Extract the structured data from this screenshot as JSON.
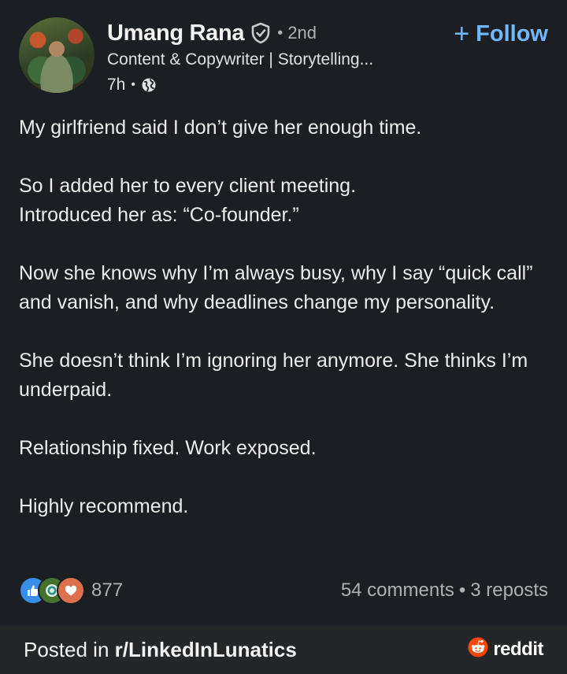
{
  "post": {
    "author": {
      "name": "Umang Rana",
      "degree": "2nd",
      "headline": "Content & Copywriter | Storytelling...",
      "time": "7h",
      "avatar_icon": "profile-photo",
      "verified_icon": "verified-shield-icon",
      "visibility_icon": "globe-icon"
    },
    "follow_label": "Follow",
    "body": [
      "My girlfriend said I don’t give her enough time.",
      "So I added her to every client meeting.\nIntroduced her as: “Co-founder.”",
      "Now she knows why I’m always busy, why I say “quick call” and vanish, and why deadlines change my personality.",
      "She doesn’t think I’m ignoring her anymore. She thinks I’m underpaid.",
      "Relationship fixed. Work exposed.",
      "Highly recommend."
    ],
    "reactions": {
      "icons": [
        "like-icon",
        "celebrate-icon",
        "love-icon"
      ],
      "count": "877"
    },
    "comments": "54 comments",
    "reposts": "3 reposts"
  },
  "footer": {
    "posted_prefix": "Posted in ",
    "subreddit": "r/LinkedInLunatics",
    "brand": "reddit",
    "brand_icon": "reddit-snoo-icon"
  },
  "colors": {
    "background": "#1b1f23",
    "footer_bg": "#242628",
    "follow_blue": "#71b7fb",
    "reddit_orange": "#ff4500"
  }
}
